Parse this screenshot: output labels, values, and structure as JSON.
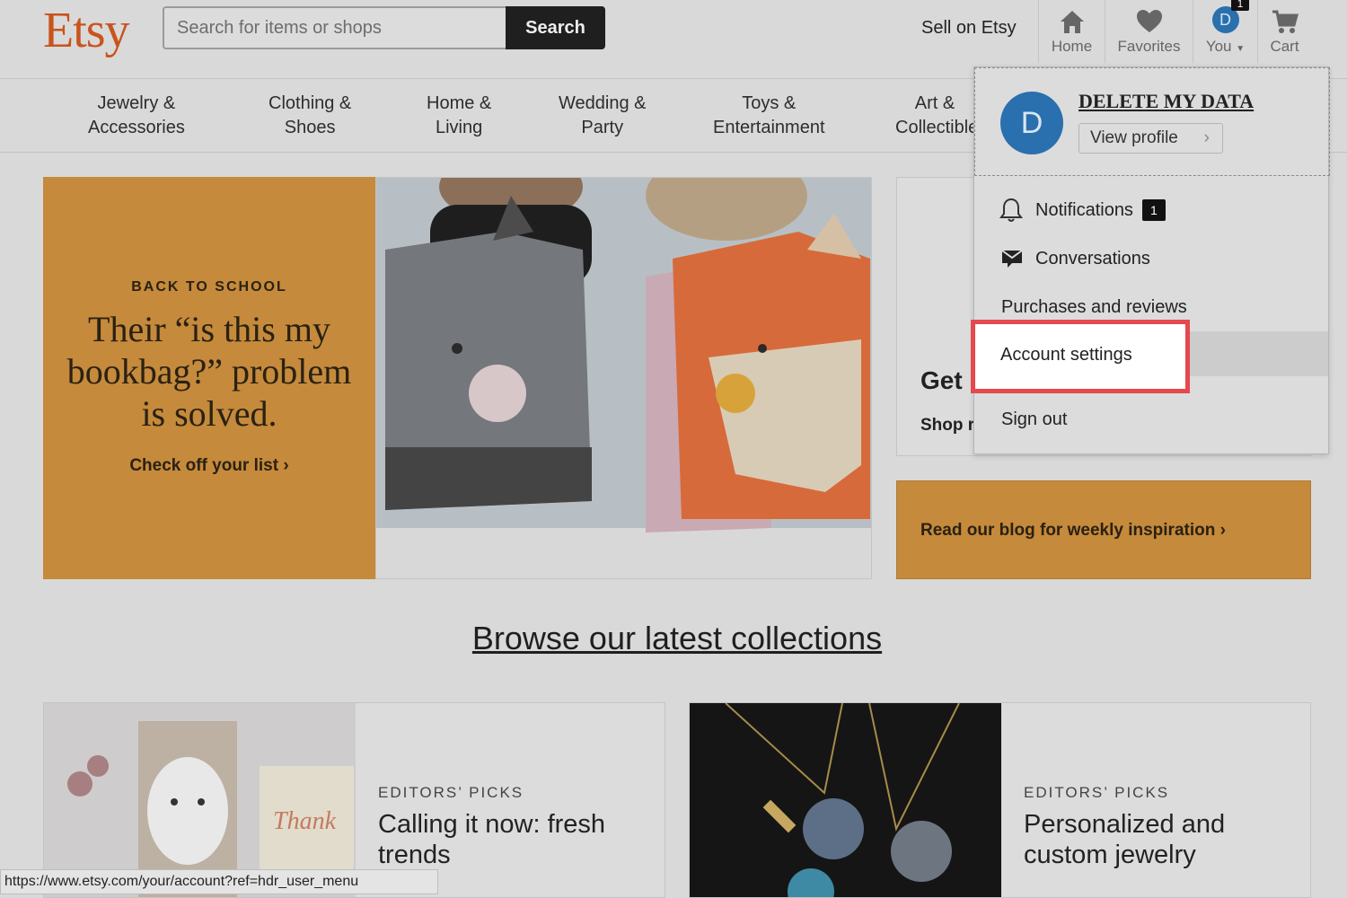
{
  "header": {
    "logo": "Etsy",
    "search_placeholder": "Search for items or shops",
    "search_button": "Search",
    "sell_link": "Sell on Etsy",
    "nav": {
      "home": "Home",
      "favorites": "Favorites",
      "you": "You",
      "you_avatar": "D",
      "you_badge": "1",
      "cart": "Cart"
    }
  },
  "categories": [
    {
      "line1": "Jewelry &",
      "line2": "Accessories"
    },
    {
      "line1": "Clothing &",
      "line2": "Shoes"
    },
    {
      "line1": "Home &",
      "line2": "Living"
    },
    {
      "line1": "Wedding &",
      "line2": "Party"
    },
    {
      "line1": "Toys &",
      "line2": "Entertainment"
    },
    {
      "line1": "Art &",
      "line2": "Collectibles"
    }
  ],
  "hero": {
    "kicker": "BACK TO SCHOOL",
    "title": "Their “is this my bookbag?” problem is solved.",
    "cta": "Check off your list ›"
  },
  "side_card": {
    "title": "Get",
    "link": "Shop r"
  },
  "blog_card": {
    "text": "Read our blog for weekly inspiration ›"
  },
  "browse": {
    "title": "Browse our latest collections"
  },
  "collections": [
    {
      "kicker": "EDITORS’ PICKS",
      "title": "Calling it now: fresh trends"
    },
    {
      "kicker": "EDITORS’ PICKS",
      "title": "Personalized and custom jewelry"
    }
  ],
  "dropdown": {
    "avatar": "D",
    "name": "DELETE MY DATA",
    "view_profile": "View profile",
    "notifications": "Notifications",
    "notifications_badge": "1",
    "conversations": "Conversations",
    "purchases": "Purchases and reviews",
    "account_settings": "Account settings",
    "sign_out": "Sign out"
  },
  "status_bar": {
    "url": "https://www.etsy.com/your/account?ref=hdr_user_menu"
  },
  "colors": {
    "brand": "#c8541c",
    "hero_orange": "#c58a3b",
    "highlight": "#e5484d",
    "avatar_blue": "#2a6fae"
  }
}
